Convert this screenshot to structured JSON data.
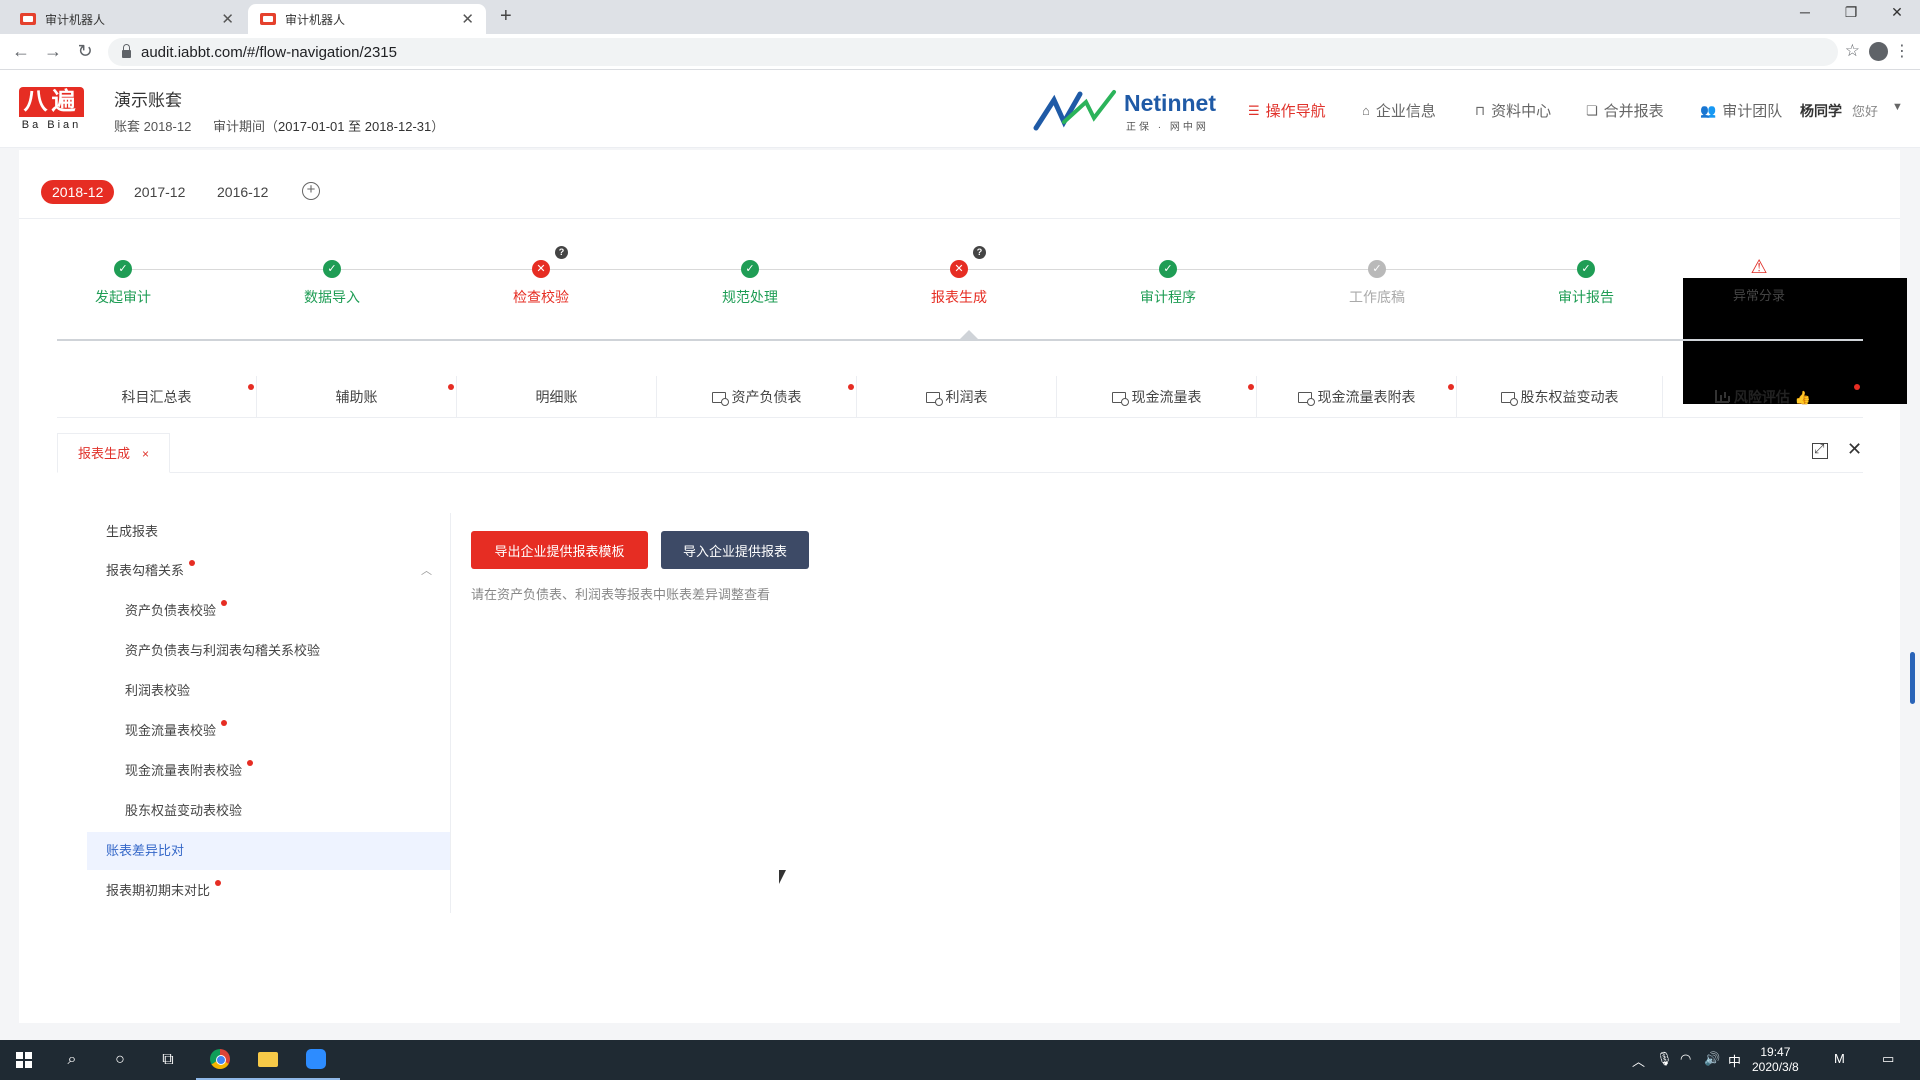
{
  "browser": {
    "tabs": [
      {
        "title": "审计机器人",
        "active": false
      },
      {
        "title": "审计机器人",
        "active": true
      }
    ],
    "url": "audit.iabbt.com/#/flow-navigation/2315"
  },
  "header": {
    "logo_text": "八遍",
    "logo_sub": "Ba Bian",
    "account_title": "演示账套",
    "account_label": "账套 2018-12",
    "period_label": "审计期间（",
    "period_range": "2017-01-01 至 2018-12-31",
    "period_close": "）",
    "partner_brand": "Netinnet",
    "partner_sub": "正保 · 网中网",
    "nav": [
      {
        "label": "操作导航",
        "icon": "list-icon",
        "active": true
      },
      {
        "label": "企业信息",
        "icon": "home-icon",
        "active": false
      },
      {
        "label": "资料中心",
        "icon": "inbox-icon",
        "active": false
      },
      {
        "label": "合并报表",
        "icon": "copy-icon",
        "active": false
      },
      {
        "label": "审计团队",
        "icon": "users-icon",
        "active": false
      }
    ],
    "user_name": "杨同学",
    "user_greeting": "您好"
  },
  "periods": [
    {
      "label": "2018-12",
      "active": true
    },
    {
      "label": "2017-12",
      "active": false
    },
    {
      "label": "2016-12",
      "active": false
    }
  ],
  "steps": [
    {
      "label": "发起审计",
      "status": "ok"
    },
    {
      "label": "数据导入",
      "status": "ok"
    },
    {
      "label": "检查校验",
      "status": "error",
      "help": "?"
    },
    {
      "label": "规范处理",
      "status": "ok"
    },
    {
      "label": "报表生成",
      "status": "error",
      "help": "?"
    },
    {
      "label": "审计程序",
      "status": "ok"
    },
    {
      "label": "工作底稿",
      "status": "pending"
    },
    {
      "label": "审计报告",
      "status": "ok"
    },
    {
      "label": "异常分录",
      "status": "alert"
    }
  ],
  "report_tabs": [
    {
      "label": "科目汇总表",
      "dot": true,
      "icon": ""
    },
    {
      "label": "辅助账",
      "dot": true,
      "icon": ""
    },
    {
      "label": "明细账",
      "dot": false,
      "icon": ""
    },
    {
      "label": "资产负债表",
      "dot": true,
      "icon": "report-search-icon"
    },
    {
      "label": "利润表",
      "dot": false,
      "icon": "report-search-icon"
    },
    {
      "label": "现金流量表",
      "dot": true,
      "icon": "report-search-icon"
    },
    {
      "label": "现金流量表附表",
      "dot": true,
      "icon": "report-search-icon"
    },
    {
      "label": "股东权益变动表",
      "dot": false,
      "icon": "report-search-icon"
    },
    {
      "label": "风险评估",
      "dot": true,
      "icon": "bar-chart-icon"
    }
  ],
  "content_tab": {
    "label": "报表生成",
    "close": "×"
  },
  "tree": [
    {
      "label": "生成报表",
      "level": 1,
      "dot": false
    },
    {
      "label": "报表勾稽关系",
      "level": 1,
      "dot": true,
      "caret": "︿"
    },
    {
      "label": "资产负债表校验",
      "level": 2,
      "dot": true
    },
    {
      "label": "资产负债表与利润表勾稽关系校验",
      "level": 2,
      "dot": false
    },
    {
      "label": "利润表校验",
      "level": 2,
      "dot": false
    },
    {
      "label": "现金流量表校验",
      "level": 2,
      "dot": true
    },
    {
      "label": "现金流量表附表校验",
      "level": 2,
      "dot": true
    },
    {
      "label": "股东权益变动表校验",
      "level": 2,
      "dot": false
    },
    {
      "label": "账表差异比对",
      "level": 1,
      "dot": false,
      "selected": true
    },
    {
      "label": "报表期初期末对比",
      "level": 1,
      "dot": true
    }
  ],
  "panel": {
    "export_button": "导出企业提供报表模板",
    "import_button": "导入企业提供报表",
    "hint": "请在资产负债表、利润表等报表中账表差异调整查看"
  },
  "taskbar": {
    "time": "19:47",
    "date": "2020/3/8",
    "ime": "中"
  },
  "colors": {
    "accent": "#e62d23",
    "success": "#1f9d55",
    "pending": "#b9b9b9",
    "import_button": "#3d4a66",
    "selected_row": "#eef3ff"
  }
}
